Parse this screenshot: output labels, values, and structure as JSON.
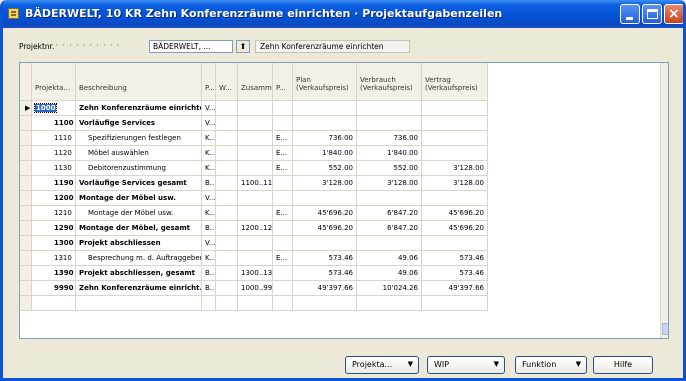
{
  "window": {
    "title": "BÄDERWELT, 10 KR Zehn Konferenzräume einrichten · Projektaufgabenzeilen"
  },
  "filter": {
    "label": "Projektnr.",
    "dots": "· · · · · · · · · · ·",
    "value": "BÄDERWELT, ...",
    "button": "⬆",
    "description": "Zehn Konferenzräume einrichten"
  },
  "columns": [
    "Projekta...",
    "Beschreibung",
    "P...",
    "W...",
    "Zusammenzä...",
    "P...",
    "Plan\n(Verkaufspreis)",
    "Verbrauch\n(Verkaufspreis)",
    "Vertrag\n(Verkaufspreis)"
  ],
  "rows": [
    {
      "id": "1000",
      "desc": "Zehn Konferenzräume einrichten",
      "p": "V...",
      "w": "",
      "sum": "",
      "p2": "",
      "plan": "",
      "verbrauch": "",
      "vertrag": "",
      "bold": true,
      "indent": 0,
      "selected": true
    },
    {
      "id": "1100",
      "desc": "Vorläufige Services",
      "p": "V...",
      "w": "",
      "sum": "",
      "p2": "",
      "plan": "",
      "verbrauch": "",
      "vertrag": "",
      "bold": true,
      "indent": 1
    },
    {
      "id": "1110",
      "desc": "Spezifizierungen festlegen",
      "p": "K...",
      "w": "",
      "sum": "",
      "p2": "E...",
      "plan": "736.00",
      "verbrauch": "736.00",
      "vertrag": "",
      "bold": false,
      "indent": 2
    },
    {
      "id": "1120",
      "desc": "Möbel auswählen",
      "p": "K...",
      "w": "",
      "sum": "",
      "p2": "E...",
      "plan": "1'840.00",
      "verbrauch": "1'840.00",
      "vertrag": "",
      "bold": false,
      "indent": 2
    },
    {
      "id": "1130",
      "desc": "Debitorenzustimmung",
      "p": "K...",
      "w": "",
      "sum": "",
      "p2": "E...",
      "plan": "552.00",
      "verbrauch": "552.00",
      "vertrag": "3'128.00",
      "bold": false,
      "indent": 2
    },
    {
      "id": "1190",
      "desc": "Vorläufige Services gesamt",
      "p": "B...",
      "w": "",
      "sum": "1100..1190",
      "p2": "",
      "plan": "3'128.00",
      "verbrauch": "3'128.00",
      "vertrag": "3'128.00",
      "bold": true,
      "indent": 1
    },
    {
      "id": "1200",
      "desc": "Montage der Möbel usw.",
      "p": "V...",
      "w": "",
      "sum": "",
      "p2": "",
      "plan": "",
      "verbrauch": "",
      "vertrag": "",
      "bold": true,
      "indent": 1
    },
    {
      "id": "1210",
      "desc": "Montage der Möbel usw.",
      "p": "K...",
      "w": "",
      "sum": "",
      "p2": "E...",
      "plan": "45'696.20",
      "verbrauch": "6'847.20",
      "vertrag": "45'696.20",
      "bold": false,
      "indent": 2
    },
    {
      "id": "1290",
      "desc": "Montage der Möbel, gesamt",
      "p": "B...",
      "w": "",
      "sum": "1200..1290",
      "p2": "",
      "plan": "45'696.20",
      "verbrauch": "6'847.20",
      "vertrag": "45'696.20",
      "bold": true,
      "indent": 1
    },
    {
      "id": "1300",
      "desc": "Projekt abschliessen",
      "p": "V...",
      "w": "",
      "sum": "",
      "p2": "",
      "plan": "",
      "verbrauch": "",
      "vertrag": "",
      "bold": true,
      "indent": 1
    },
    {
      "id": "1310",
      "desc": "Besprechung m. d. Auftraggeber",
      "p": "K...",
      "w": "",
      "sum": "",
      "p2": "E...",
      "plan": "573.46",
      "verbrauch": "49.06",
      "vertrag": "573.46",
      "bold": false,
      "indent": 2
    },
    {
      "id": "1390",
      "desc": "Projekt abschliessen, gesamt",
      "p": "B...",
      "w": "",
      "sum": "1300..1390",
      "p2": "",
      "plan": "573.46",
      "verbrauch": "49.06",
      "vertrag": "573.46",
      "bold": true,
      "indent": 1
    },
    {
      "id": "9990",
      "desc": "Zehn Konferenzräume einricht...",
      "p": "B...",
      "w": "",
      "sum": "1000..9990",
      "p2": "",
      "plan": "49'397.66",
      "verbrauch": "10'024.26",
      "vertrag": "49'397.66",
      "bold": true,
      "indent": 1
    },
    {
      "id": "",
      "desc": "",
      "p": "",
      "w": "",
      "sum": "",
      "p2": "",
      "plan": "",
      "verbrauch": "",
      "vertrag": "",
      "bold": false,
      "indent": 0
    }
  ],
  "buttons": [
    {
      "label": "Projekta...",
      "dropdown": true
    },
    {
      "label": "WIP",
      "dropdown": true
    },
    {
      "label": "Funktion",
      "dropdown": true
    },
    {
      "label": "Hilfe",
      "dropdown": false
    }
  ],
  "colors": {
    "titlebar": "#0453d6",
    "window_bg": "#ece9d8",
    "selection": "#3166c4"
  }
}
